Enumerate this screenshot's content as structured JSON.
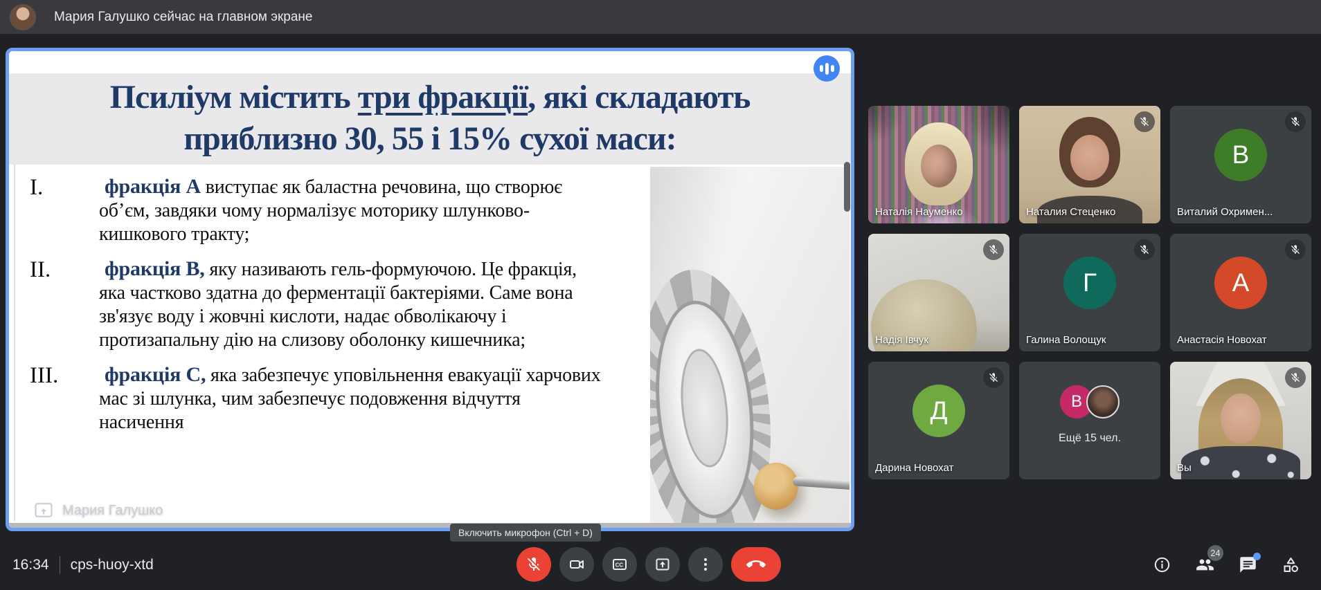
{
  "top_bar": {
    "status_text": "Мария Галушко сейчас на главном экране"
  },
  "shared_screen": {
    "watermark": "Мария Галушко",
    "slide": {
      "title_line1_pre": "Псиліум містить ",
      "title_line1_underlined": "три фракції",
      "title_line1_post": ", які складають",
      "title_line2": "приблизно 30, 55 і 15% сухої маси:",
      "items": [
        {
          "num": "I.",
          "lead": "фракція А",
          "text": " виступає як баластна речовина, що створює об’єм, завдяки чому нормалізує моторику шлунково-кишкового тракту;"
        },
        {
          "num": "II.",
          "lead": "фракція В,",
          "text": " яку називають гель-формуючою. Це фракція, яка частково здатна до ферментації бактеріями. Саме вона зв'язує воду і жовчні кислоти, надає обволікаючу і протизапальну дію на слизову оболонку кишечника;"
        },
        {
          "num": "III.",
          "lead": "фракція С,",
          "text": " яка забезпечує уповільнення евакуації харчових мас зі шлунка, чим забезпечує подовження відчуття насичення"
        }
      ]
    }
  },
  "participants": [
    {
      "name": "Наталія Науменко",
      "kind": "video",
      "muted": false
    },
    {
      "name": "Наталия Стеценко",
      "kind": "video",
      "muted": true
    },
    {
      "name": "Виталий Охримен...",
      "kind": "initial",
      "initial": "В",
      "color": "#3d7d28",
      "muted": true
    },
    {
      "name": "Надія Івчук",
      "kind": "video",
      "muted": true
    },
    {
      "name": "Галина Волощук",
      "kind": "initial",
      "initial": "Г",
      "color": "#0f6a5c",
      "muted": true
    },
    {
      "name": "Анастасія Новохат",
      "kind": "initial",
      "initial": "А",
      "color": "#d5492b",
      "muted": true
    },
    {
      "name": "Дарина Новохат",
      "kind": "initial",
      "initial": "Д",
      "color": "#6fa942",
      "muted": true
    },
    {
      "name": "Ещё 15 чел.",
      "kind": "group",
      "initial": "В",
      "color": "#c62a66",
      "muted": false
    },
    {
      "name": "Вы",
      "kind": "video",
      "muted": true
    }
  ],
  "tooltip": {
    "mic": "Включить микрофон (Ctrl + D)"
  },
  "bottom_bar": {
    "time": "16:34",
    "meeting_code": "cps-huoy-xtd",
    "participants_count": "24",
    "center_buttons": [
      "mic-off",
      "camera",
      "captions",
      "present",
      "more",
      "end-call"
    ],
    "right_buttons": [
      "info",
      "people",
      "chat",
      "activities"
    ]
  },
  "colors": {
    "share_border_blue": "#6d9eef",
    "audio_chip_blue": "#4184f3",
    "danger_red": "#ea4335",
    "title_navy": "#1f3a66",
    "badge_gray": "#5f6368",
    "unread_blue": "#5e97f6"
  }
}
